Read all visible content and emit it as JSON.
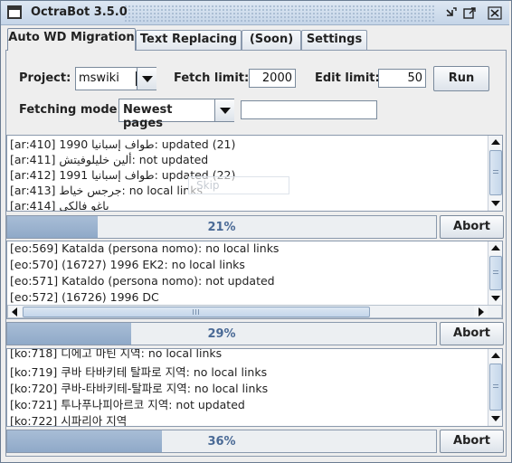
{
  "window": {
    "title": "OctraBot 3.5.0"
  },
  "tabs": [
    {
      "label": "Auto WD Migration"
    },
    {
      "label": "Text Replacing"
    },
    {
      "label": "(Soon)"
    },
    {
      "label": "Settings"
    }
  ],
  "form": {
    "project_label": "Project:",
    "project_value": "mswiki",
    "fetch_limit_label": "Fetch limit:",
    "fetch_limit_value": "2000",
    "edit_limit_label": "Edit limit:",
    "edit_limit_value": "50",
    "run_label": "Run",
    "fetching_mode_label": "Fetching mode:",
    "fetching_mode_value": "Newest pages",
    "fetching_mode_extra_value": ""
  },
  "panels": [
    {
      "lines": [
        "[ar:410] طواف إسبانيا 1990: updated (21)",
        "[ar:411] ألين خليلوفيتش: not updated",
        "[ar:412] طواف إسبانيا 1991: updated (22)",
        "[ar:413] جرجس خياط: no local links",
        "[ar:414] ياغو فالكي"
      ],
      "ghost_text": "Skip",
      "progress_percent": 21,
      "progress_label": "21%",
      "abort_label": "Abort"
    },
    {
      "lines": [
        "[eo:569] Katalda (persona nomo): no local links",
        "[eo:570] (16727) 1996 EK2: no local links",
        "[eo:571] Kataldo (persona nomo): not updated",
        "[eo:572] (16726) 1996 DC"
      ],
      "progress_percent": 29,
      "progress_label": "29%",
      "abort_label": "Abort"
    },
    {
      "lines": [
        "[ko:718] 디에고 마틴 지역: no local links",
        "[ko:719] 쿠바 타바키테 탈파로 지역: no local links",
        "[ko:720] 쿠바-타바키테-탈파로 지역: no local links",
        "[ko:721] 투나푸나피아르코 지역: not updated",
        "[ko:722] 시파리아 지역"
      ],
      "progress_percent": 36,
      "progress_label": "36%",
      "abort_label": "Abort"
    }
  ]
}
